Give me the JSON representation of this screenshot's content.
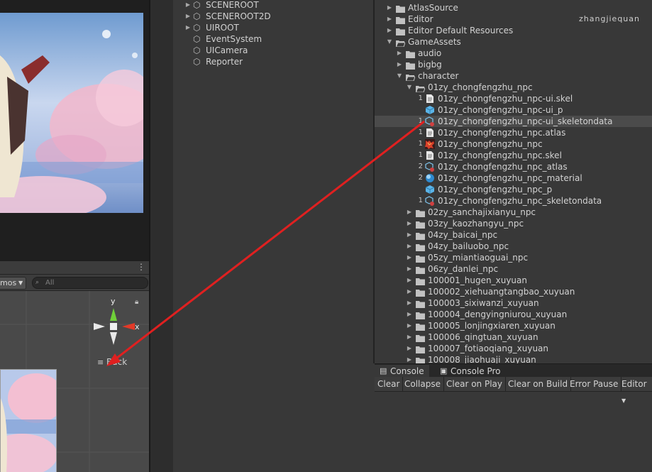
{
  "watermark": "zhangjiequan",
  "hierarchy": {
    "items": [
      {
        "label": "SCENEROOT",
        "expandable": true
      },
      {
        "label": "SCENEROOT2D",
        "expandable": true
      },
      {
        "label": "UIROOT",
        "expandable": true
      },
      {
        "label": "EventSystem",
        "expandable": false
      },
      {
        "label": "UICamera",
        "expandable": false
      },
      {
        "label": "Reporter",
        "expandable": false
      }
    ]
  },
  "scene": {
    "gizmos_label": "mos",
    "search_placeholder": "All",
    "axis_y": "y",
    "axis_x": "x",
    "back_label": "Back"
  },
  "project": {
    "folders_top": [
      {
        "label": "AtlasSource",
        "expanded": false
      },
      {
        "label": "Editor",
        "expanded": false
      },
      {
        "label": "Editor Default Resources",
        "expanded": false
      },
      {
        "label": "GameAssets",
        "expanded": true
      }
    ],
    "gameassets_children": [
      {
        "label": "audio",
        "expanded": false
      },
      {
        "label": "bigbg",
        "expanded": false
      },
      {
        "label": "character",
        "expanded": true
      }
    ],
    "open_folder": "01zy_chongfengzhu_npc",
    "assets": [
      {
        "badge": "1",
        "icon": "text-asset-icon",
        "label": "01zy_chongfengzhu_npc-ui.skel",
        "selected": false
      },
      {
        "badge": "",
        "icon": "prefab-icon",
        "label": "01zy_chongfengzhu_npc-ui_p",
        "selected": false
      },
      {
        "badge": "1",
        "icon": "skeleton-data-icon",
        "label": "01zy_chongfengzhu_npc-ui_skeletondata",
        "selected": true
      },
      {
        "badge": "1",
        "icon": "text-asset-icon",
        "label": "01zy_chongfengzhu_npc.atlas",
        "selected": false
      },
      {
        "badge": "1",
        "icon": "texture-icon",
        "label": "01zy_chongfengzhu_npc",
        "selected": false
      },
      {
        "badge": "1",
        "icon": "text-asset-icon",
        "label": "01zy_chongfengzhu_npc.skel",
        "selected": false
      },
      {
        "badge": "2",
        "icon": "atlas-asset-icon",
        "label": "01zy_chongfengzhu_npc_atlas",
        "selected": false
      },
      {
        "badge": "2",
        "icon": "material-icon",
        "label": "01zy_chongfengzhu_npc_material",
        "selected": false
      },
      {
        "badge": "",
        "icon": "prefab-icon",
        "label": "01zy_chongfengzhu_npc_p",
        "selected": false
      },
      {
        "badge": "1",
        "icon": "skeleton-data-icon",
        "label": "01zy_chongfengzhu_npc_skeletondata",
        "selected": false
      }
    ],
    "sibling_folders": [
      "02zy_sanchajixianyu_npc",
      "03zy_kaozhangyu_npc",
      "04zy_baicai_npc",
      "04zy_bailuobo_npc",
      "05zy_miantiaoguai_npc",
      "06zy_danlei_npc",
      "100001_hugen_xuyuan",
      "100002_xiehuangtangbao_xuyuan",
      "100003_sixiwanzi_xuyuan",
      "100004_dengyingniurou_xuyuan",
      "100005_lonjingxiaren_xuyuan",
      "100006_qingtuan_xuyuan",
      "100007_fotiaoqiang_xuyuan",
      "100008_jiaohuaji_xuyuan"
    ]
  },
  "console": {
    "tabs": [
      "Console",
      "Console Pro"
    ],
    "buttons": [
      "Clear",
      "Collapse",
      "Clear on Play",
      "Clear on Build",
      "Error Pause",
      "Editor"
    ]
  },
  "colors": {
    "annotation_arrow": "#e02020",
    "selection_row": "#4b4b4b",
    "prefab_blue": "#5ab4e8"
  }
}
